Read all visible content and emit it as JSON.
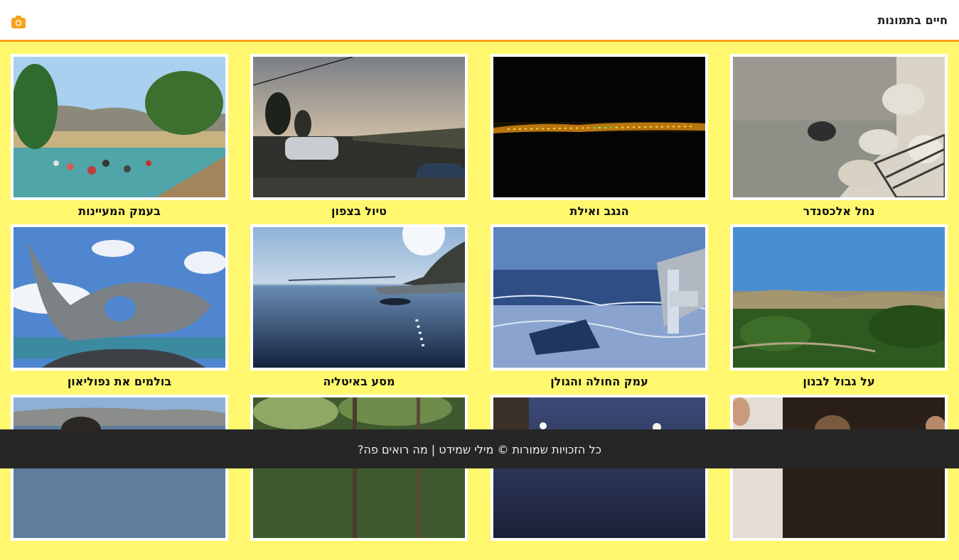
{
  "header": {
    "title": "חיים בתמונות",
    "icon": "camera-icon"
  },
  "colors": {
    "background": "#fff86e",
    "accent": "#f7a21b",
    "footer": "#262626"
  },
  "gallery": {
    "items": [
      {
        "caption": "נחל אלכסנדר",
        "scene": "rocks"
      },
      {
        "caption": "הנגב ואילת",
        "scene": "night"
      },
      {
        "caption": "טיול בצפון",
        "scene": "sunset"
      },
      {
        "caption": "בעמק המעיינות",
        "scene": "pool"
      },
      {
        "caption": "על גבול לבנון",
        "scene": "hills"
      },
      {
        "caption": "עמק החולה והגולן",
        "scene": "snow"
      },
      {
        "caption": "מסע באיטליה",
        "scene": "sea"
      },
      {
        "caption": "בולמים את נפוליאון",
        "scene": "whale"
      },
      {
        "caption": "",
        "scene": "indoor"
      },
      {
        "caption": "",
        "scene": "dusk"
      },
      {
        "caption": "",
        "scene": "forest"
      },
      {
        "caption": "",
        "scene": "lake"
      }
    ]
  },
  "footer": {
    "text": "כל הזכויות שמורות © מילי שמידט | מה רואים פה?"
  }
}
